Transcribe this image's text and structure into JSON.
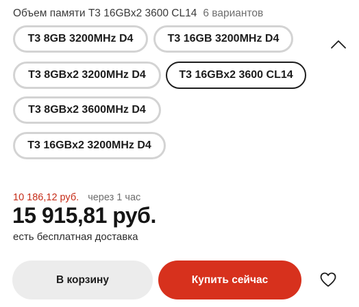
{
  "header": {
    "label": "Объем памяти T3 16GBx2 3600 CL14",
    "variant_count": "6 вариантов"
  },
  "options": [
    {
      "label": "T3 8GB 3200MHz D4",
      "selected": false
    },
    {
      "label": "T3 16GB 3200MHz D4",
      "selected": false
    },
    {
      "label": "T3 8GBx2 3200MHz D4",
      "selected": false
    },
    {
      "label": "T3 16GBx2 3600 CL14",
      "selected": true
    },
    {
      "label": "T3 8GBx2 3600MHz D4",
      "selected": false
    },
    {
      "label": "T3 16GBx2 3200MHz D4",
      "selected": false
    }
  ],
  "price": {
    "promo_price": "10 186,12 руб.",
    "promo_note": "через 1 час",
    "current": "15 915,81 руб.",
    "delivery": "есть бесплатная доставка"
  },
  "actions": {
    "cart_label": "В корзину",
    "buy_label": "Купить сейчас"
  },
  "icons": {
    "collapse": "chevron-up-icon",
    "favorite": "heart-icon"
  },
  "colors": {
    "accent": "#d7311d",
    "promo_price": "#c62d19",
    "chip_border": "#d3d3d3",
    "chip_selected_border": "#1c1c1c",
    "cart_button": "#ececec"
  }
}
